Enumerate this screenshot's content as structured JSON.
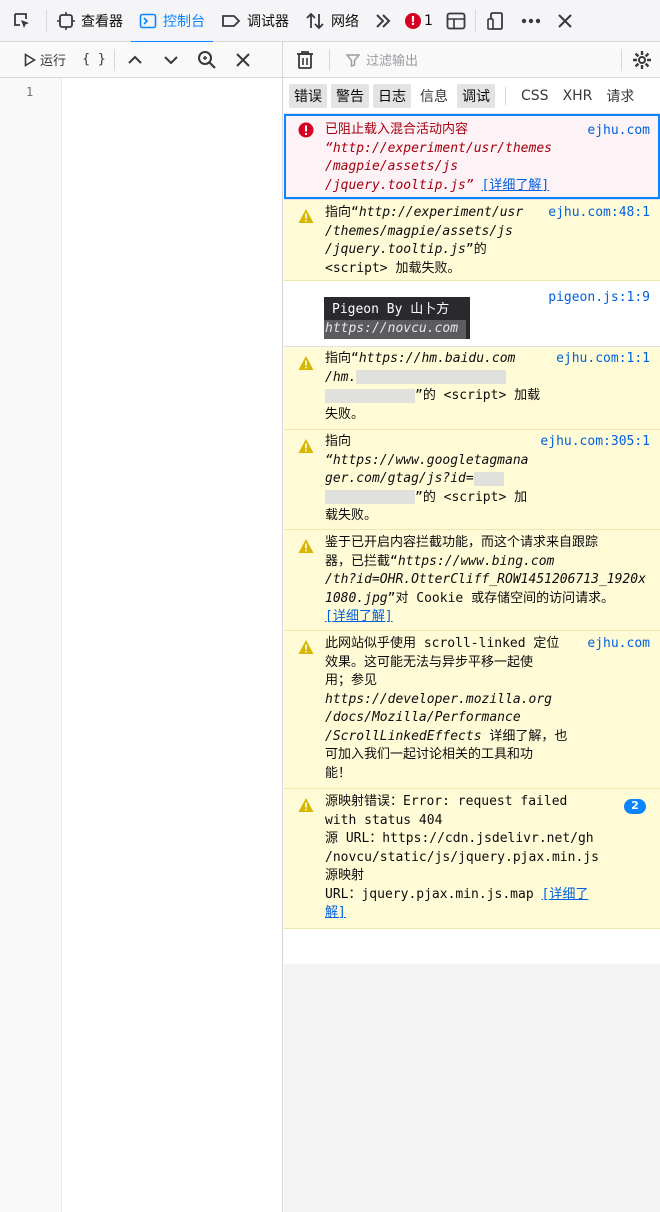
{
  "tabs": {
    "inspector": "查看器",
    "console": "控制台",
    "debugger": "调试器",
    "network": "网络",
    "error_count": "1"
  },
  "toolbar": {
    "run_label": "运行",
    "braces": "{ }",
    "filter_placeholder": "过滤输出"
  },
  "editor": {
    "line_number": "1"
  },
  "filters": {
    "errors": "错误",
    "warnings": "警告",
    "logs": "日志",
    "info": "信息",
    "debug": "调试",
    "css": "CSS",
    "xhr": "XHR",
    "requests": "请求"
  },
  "messages": {
    "m1": {
      "line1": "已阻止载入混合活动内容",
      "line2": "“http://experiment/usr/themes",
      "line3": "/magpie/assets/js",
      "line4": "/jquery.tooltip.js”",
      "link": "[详细了解]",
      "source": "ejhu.com"
    },
    "m2": {
      "line1a": "指向“",
      "line1b": "http://experiment/usr",
      "line2": "/themes/magpie/assets/js",
      "line3a": "/jquery.tooltip.js",
      "line3b": "”的",
      "line4": "<script> 加载失败。",
      "source": "ejhu.com:48:1"
    },
    "m3": {
      "line1": "Pigeon By 山卜方",
      "line2": "https://novcu.com",
      "source": "pigeon.js:1:9"
    },
    "m4": {
      "line1a": "指向“",
      "line1b": "https://hm.baidu.com",
      "line2": "/hm.",
      "line3": "”的 <script> 加载",
      "line4": "失败。",
      "source": "ejhu.com:1:1"
    },
    "m5": {
      "line1": "指向",
      "line2": "“https://www.googletagmana",
      "line3": "ger.com/gtag/js?id=",
      "line4": "”的 <script> 加",
      "line5": "载失败。",
      "source": "ejhu.com:305:1"
    },
    "m6": {
      "line1": "鉴于已开启内容拦截功能，而这个请求来自跟踪",
      "line2a": "器，已拦截“",
      "line2b": "https://www.bing.com",
      "line3": "/th?id=OHR.OtterCliff_ROW1451206713_1920x",
      "line4a": "1080.jpg",
      "line4b": "”对 Cookie 或存储空间的访问请求。",
      "link": "[详细了解]"
    },
    "m7": {
      "line1": "此网站似乎使用 scroll-linked 定位",
      "line2": "效果。这可能无法与异步平移一起使",
      "line3": "用；参见",
      "line4": "https://developer.mozilla.org",
      "line5": "/docs/Mozilla/Performance",
      "line6a": "/ScrollLinkedEffects",
      "line6b": " 详细了解，也",
      "line7": "可加入我们一起讨论相关的工具和功",
      "line8": "能！",
      "source": "ejhu.com"
    },
    "m8": {
      "line1": "源映射错误：Error: request failed",
      "line2": "with status 404",
      "line3": "源 URL：https://cdn.jsdelivr.net/gh",
      "line4": "/novcu/static/js/jquery.pjax.min.js",
      "line5": "源映射",
      "line6": "URL：jquery.pjax.min.js.map ",
      "link1": "[详细了",
      "link2": "解]",
      "badge": "2"
    }
  }
}
